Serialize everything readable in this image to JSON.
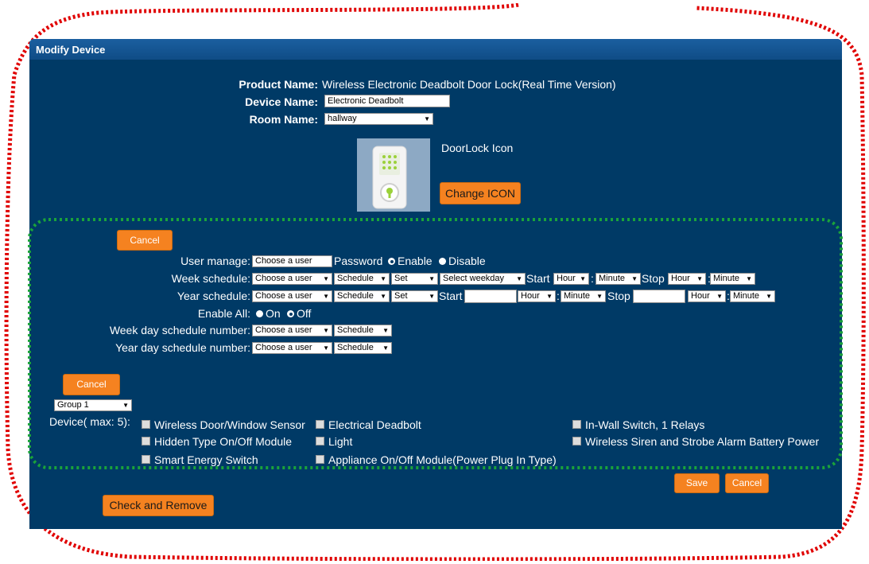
{
  "panel_title": "Modify Device",
  "product": {
    "label": "Product Name:",
    "value": "Wireless Electronic Deadbolt Door Lock(Real Time Version)"
  },
  "device_name": {
    "label": "Device Name:",
    "value": "Electronic Deadbolt"
  },
  "room_name": {
    "label": "Room Name:",
    "value": "hallway"
  },
  "icon": {
    "caption": "DoorLock Icon",
    "change_label": "Change ICON"
  },
  "user_section": {
    "cancel_label": "Cancel",
    "user_manage": {
      "label": "User manage:",
      "user": "Choose a user",
      "password_label": "Password",
      "enable": "Enable",
      "disable": "Disable"
    },
    "week_schedule": {
      "label": "Week schedule:",
      "user": "Choose a user",
      "schedule": "Schedule",
      "set": "Set",
      "weekday": "Select weekday",
      "start": "Start",
      "hour": "Hour",
      "minute": "Minute",
      "stop": "Stop",
      "sep": ":"
    },
    "year_schedule": {
      "label": "Year schedule:",
      "user": "Choose a user",
      "schedule": "Schedule",
      "set": "Set",
      "start": "Start",
      "hour": "Hour",
      "minute": "Minute",
      "stop": "Stop",
      "sep": ":"
    },
    "enable_all": {
      "label": "Enable All:",
      "on": "On",
      "off": "Off"
    },
    "week_day_number": {
      "label": "Week day schedule number:",
      "user": "Choose a user",
      "schedule": "Schedule"
    },
    "year_day_number": {
      "label": "Year day schedule number:",
      "user": "Choose a user",
      "schedule": "Schedule"
    }
  },
  "group_section": {
    "cancel_label": "Cancel",
    "group": "Group 1",
    "device_label": "Device( max: 5):",
    "devices": [
      "Wireless Door/Window Sensor",
      "Electrical Deadbolt",
      "In-Wall Switch, 1 Relays",
      "Hidden Type On/Off Module",
      "Light",
      "Wireless Siren and Strobe Alarm Battery Power",
      "Smart Energy Switch",
      "Appliance On/Off Module(Power Plug In Type)"
    ]
  },
  "footer": {
    "save_label": "Save",
    "cancel_label": "Cancel",
    "check_remove_label": "Check and Remove"
  },
  "colors": {
    "panel": "#003a66",
    "title_bar": "#1b5fa0",
    "button": "#f58220",
    "red_outline": "#e00000",
    "green_outline": "#1aa33a"
  }
}
